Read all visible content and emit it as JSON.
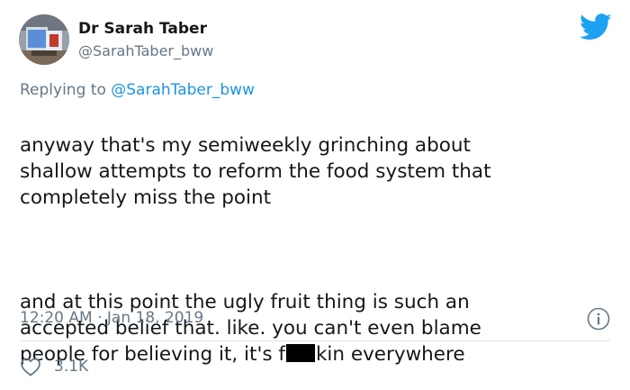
{
  "author": {
    "display_name": "Dr Sarah Taber",
    "handle": "@SarahTaber_bww"
  },
  "reply": {
    "prefix": "Replying to ",
    "mention": "@SarahTaber_bww"
  },
  "tweet": {
    "paragraph1": "anyway that's my semiweekly grinching about\nshallow attempts to reform the food system that\ncompletely miss the point",
    "paragraph2_line1": "and at this point the ugly fruit thing is such an\naccepted belief that. like. you can't even blame",
    "paragraph2_line3_before": "people for believing it, it's f",
    "paragraph2_line3_after": "kin everywhere"
  },
  "timestamp": "12:20 AM · Jan 18, 2019",
  "actions": {
    "like_count": "3.1K"
  },
  "icons": {
    "brand": "twitter-bird-icon",
    "info": "info-icon",
    "like": "heart-icon"
  },
  "colors": {
    "twitter_blue": "#1da1f2",
    "secondary_text": "#657786",
    "mention_link": "#1b95e0"
  }
}
